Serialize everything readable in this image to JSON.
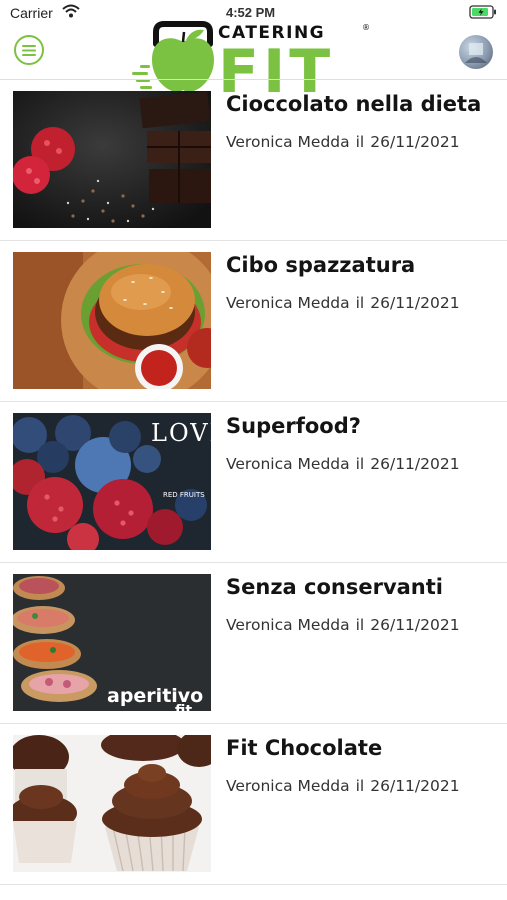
{
  "status_bar": {
    "carrier": "Carrier",
    "time": "4:52 PM"
  },
  "header": {
    "logo_word_top": "CATERING",
    "logo_registered": "®",
    "logo_word_main": "FIT",
    "brand_color": "#7cc242",
    "menu_icon": "hamburger-menu-icon",
    "avatar_icon": "user-avatar"
  },
  "articles": [
    {
      "title": "Cioccolato nella dieta",
      "author": "Veronica Medda",
      "connector": "il",
      "date": "26/11/2021",
      "image": "chocolate-raspberries-photo"
    },
    {
      "title": "Cibo spazzatura",
      "author": "Veronica Medda",
      "connector": "il",
      "date": "26/11/2021",
      "image": "burger-photo"
    },
    {
      "title": "Superfood?",
      "author": "Veronica Medda",
      "connector": "il",
      "date": "26/11/2021",
      "image": "berries-love-photo",
      "image_text": "LOVE",
      "image_subtext": "RED FRUITS"
    },
    {
      "title": "Senza conservanti",
      "author": "Veronica Medda",
      "connector": "il",
      "date": "26/11/2021",
      "image": "aperitivo-fit-photo",
      "image_text": "aperitivo",
      "image_subtext": "fit"
    },
    {
      "title": "Fit Chocolate",
      "author": "Veronica Medda",
      "connector": "il",
      "date": "26/11/2021",
      "image": "chocolate-cupcakes-photo"
    }
  ]
}
